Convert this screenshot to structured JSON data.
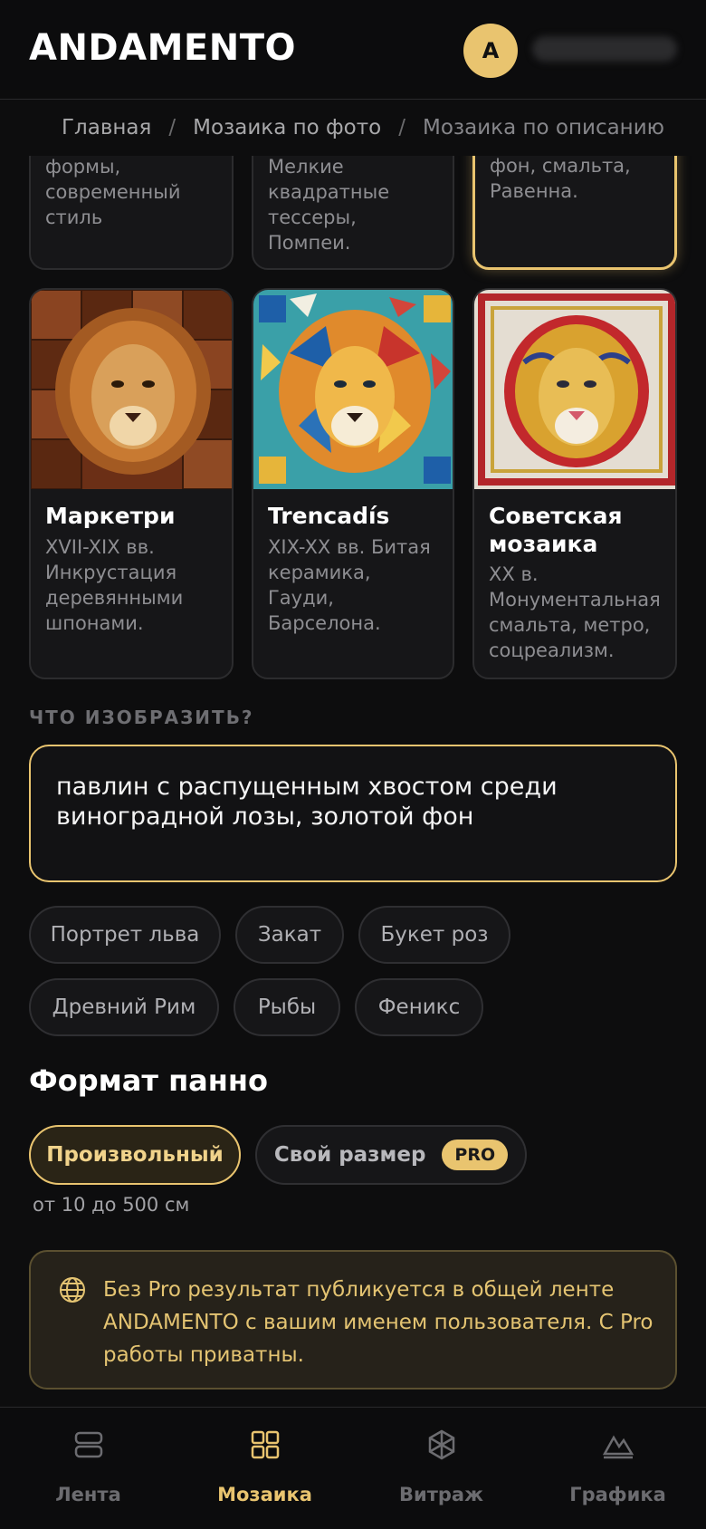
{
  "header": {
    "logo": "ANDAMENTO",
    "avatar_initial": "A"
  },
  "breadcrumb": [
    "Главная",
    "Мозаика по фото",
    "Мозаика по описанию"
  ],
  "cards_top": [
    {
      "desc": "формы,\nсовременный\nстиль"
    },
    {
      "desc": "Мелкие\nквадратные\nтессеры,\nПомпеи."
    },
    {
      "desc": "фон, смальта,\nРавенна."
    }
  ],
  "cards": [
    {
      "title": "Маркетри",
      "desc": "XVII-XIX вв.\nИнкрустация\nдеревянными\nшпонами."
    },
    {
      "title": "Trencadís",
      "desc": "XIX-XX вв. Битая\nкерамика, Гауди,\nБарселона."
    },
    {
      "title": "Советская\nмозаика",
      "desc": "XX в.\nМонументальная\nсмальта, метро,\nсоцреализм."
    }
  ],
  "prompt": {
    "label": "ЧТО ИЗОБРАЗИТЬ?",
    "value": "павлин с распущенным хвостом среди виноградной лозы, золотой фон"
  },
  "suggestions": [
    "Портрет льва",
    "Закат",
    "Букет роз",
    "Древний Рим",
    "Рыбы",
    "Феникс"
  ],
  "format": {
    "title": "Формат панно",
    "options": [
      "Произвольный",
      "Свой размер"
    ],
    "pro_badge": "PRO",
    "hint": "от 10 до 500 см"
  },
  "notice": "Без Pro результат публикуется в общей ленте ANDAMENTO с вашим именем пользователя. С Pro работы приватны.",
  "nav": [
    {
      "label": "Лента",
      "icon": "feed-icon"
    },
    {
      "label": "Мозаика",
      "icon": "grid-icon"
    },
    {
      "label": "Витраж",
      "icon": "stained-glass-icon"
    },
    {
      "label": "Графика",
      "icon": "mountain-icon"
    }
  ],
  "colors": {
    "accent": "#e9c46f",
    "background": "#0d0d0e",
    "card": "#161618"
  }
}
